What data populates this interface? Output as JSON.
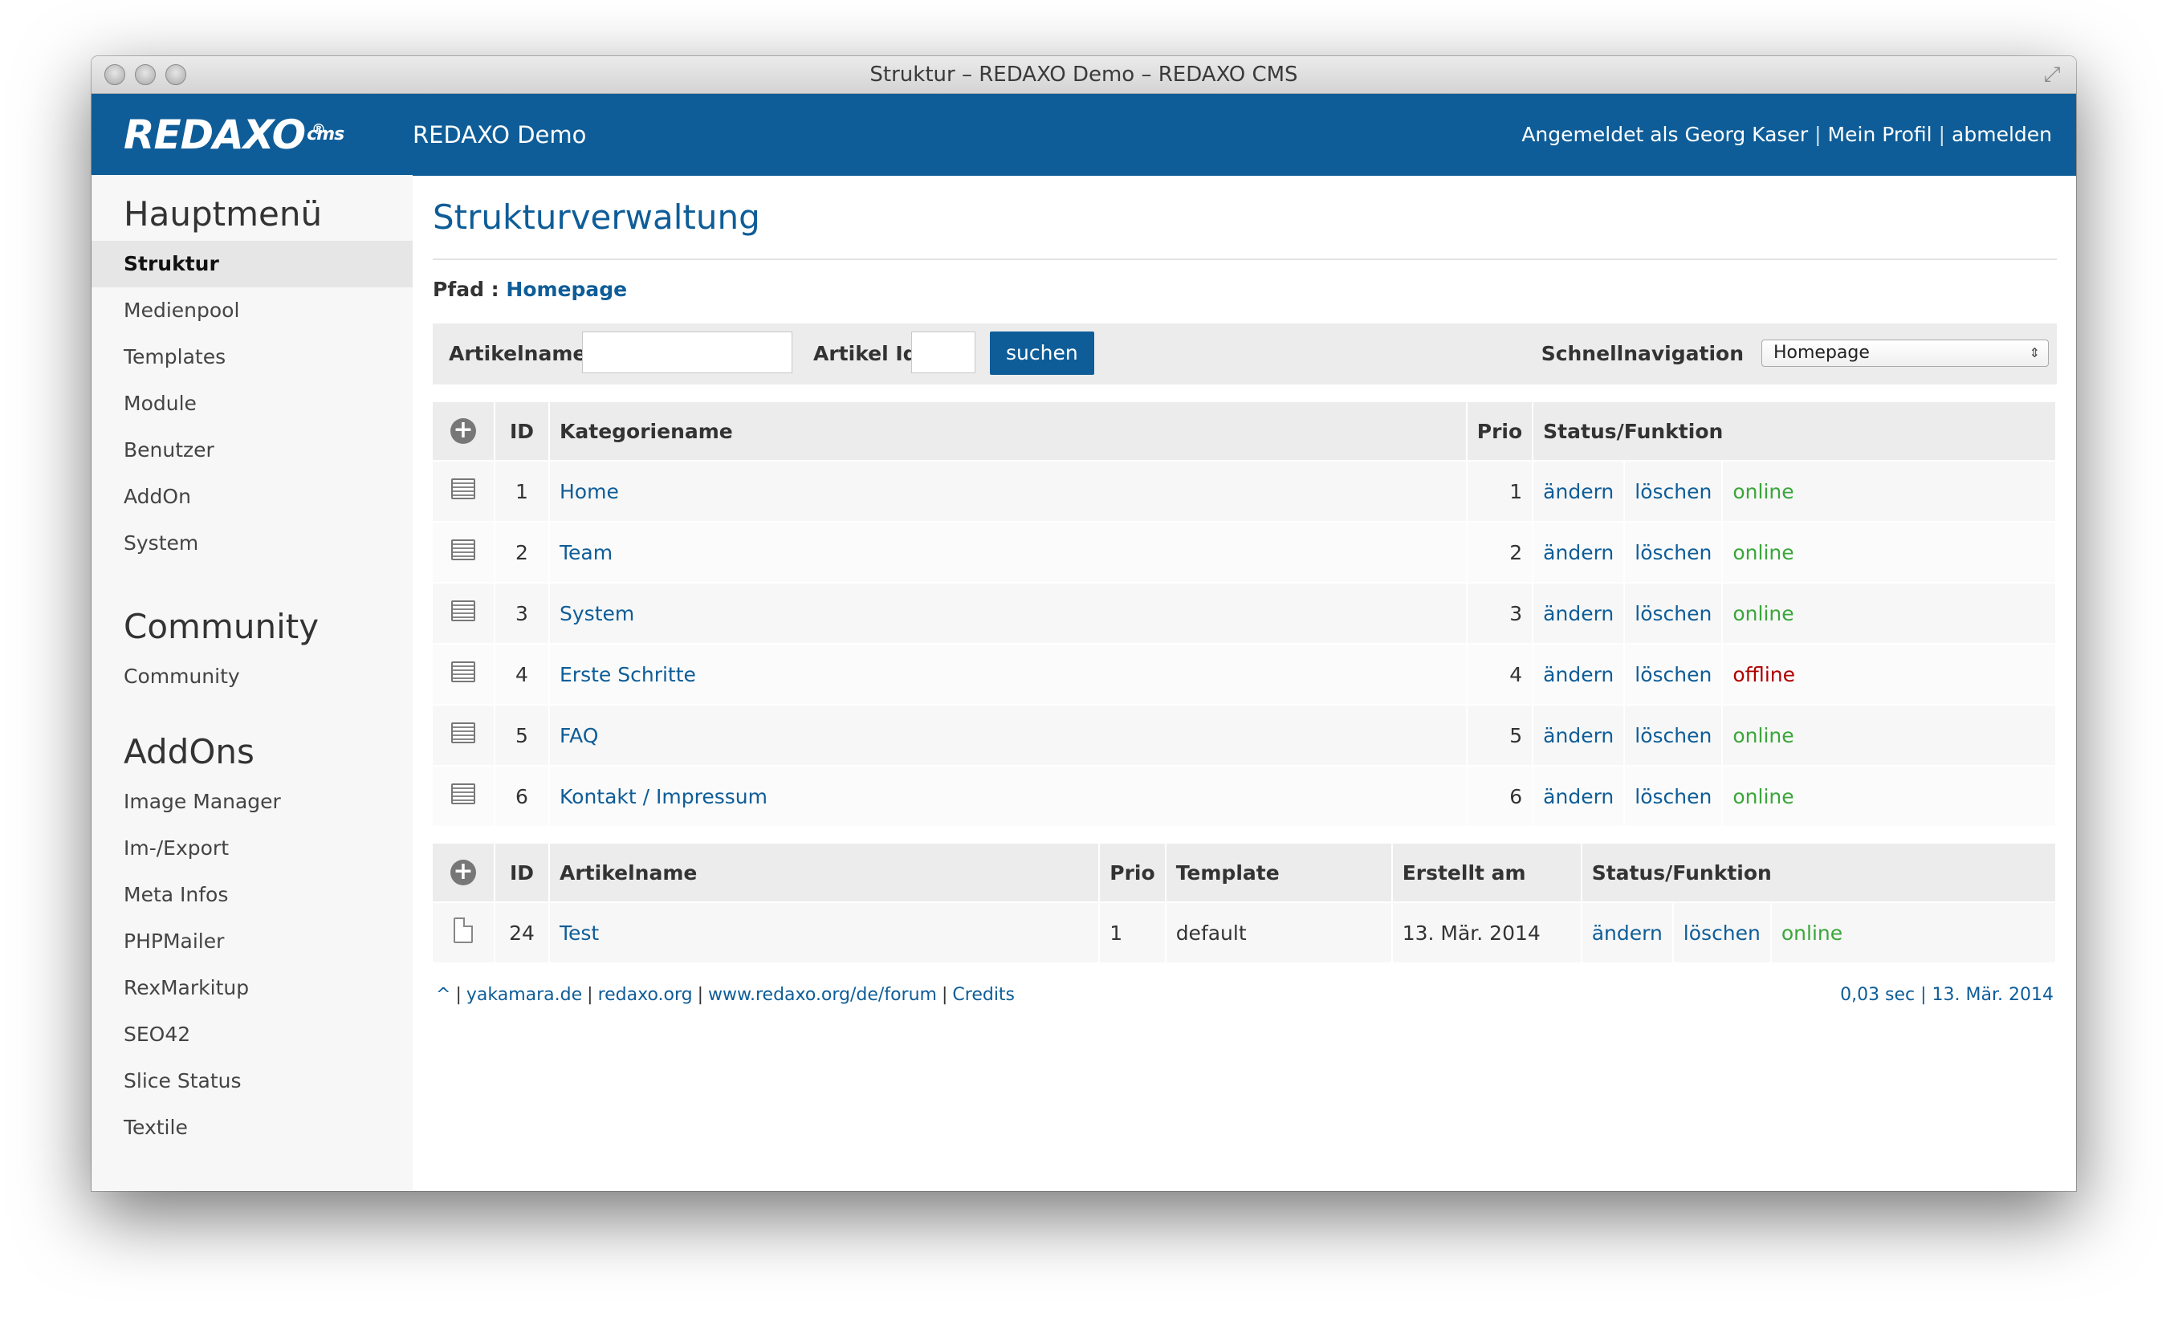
{
  "window": {
    "title": "Struktur – REDAXO Demo – REDAXO CMS"
  },
  "header": {
    "logo": "REDAXO",
    "logo_suffix": "cms",
    "logo_mark": "®",
    "site_name": "REDAXO Demo",
    "logged_in_label": "Angemeldet als Georg Kaser",
    "profile_link": "Mein Profil",
    "logout_link": "abmelden",
    "accent_color": "#0e5d98"
  },
  "sidebar": {
    "main_heading": "Hauptmenü",
    "main_items": [
      {
        "label": "Struktur",
        "active": true
      },
      {
        "label": "Medienpool"
      },
      {
        "label": "Templates"
      },
      {
        "label": "Module"
      },
      {
        "label": "Benutzer"
      },
      {
        "label": "AddOn"
      },
      {
        "label": "System"
      }
    ],
    "community_heading": "Community",
    "community_items": [
      {
        "label": "Community"
      }
    ],
    "addons_heading": "AddOns",
    "addon_items": [
      {
        "label": "Image Manager"
      },
      {
        "label": "Im-/Export"
      },
      {
        "label": "Meta Infos"
      },
      {
        "label": "PHPMailer"
      },
      {
        "label": "RexMarkitup"
      },
      {
        "label": "SEO42"
      },
      {
        "label": "Slice Status"
      },
      {
        "label": "Textile"
      }
    ]
  },
  "main": {
    "title": "Strukturverwaltung",
    "path_label": "Pfad :",
    "path_link": "Homepage",
    "search": {
      "article_name_label": "Artikelname",
      "article_name_value": "",
      "article_id_label": "Artikel Id",
      "article_id_value": "",
      "search_button": "suchen",
      "quicknav_label": "Schnellnavigation",
      "quicknav_selected": "Homepage"
    },
    "categories": {
      "headers": {
        "id": "ID",
        "name": "Kategoriename",
        "prio": "Prio",
        "status": "Status/Funktion"
      },
      "rows": [
        {
          "id": "1",
          "name": "Home",
          "prio": "1",
          "edit": "ändern",
          "delete": "löschen",
          "status": "online"
        },
        {
          "id": "2",
          "name": "Team",
          "prio": "2",
          "edit": "ändern",
          "delete": "löschen",
          "status": "online"
        },
        {
          "id": "3",
          "name": "System",
          "prio": "3",
          "edit": "ändern",
          "delete": "löschen",
          "status": "online"
        },
        {
          "id": "4",
          "name": "Erste Schritte",
          "prio": "4",
          "edit": "ändern",
          "delete": "löschen",
          "status": "offline"
        },
        {
          "id": "5",
          "name": "FAQ",
          "prio": "5",
          "edit": "ändern",
          "delete": "löschen",
          "status": "online"
        },
        {
          "id": "6",
          "name": "Kontakt / Impressum",
          "prio": "6",
          "edit": "ändern",
          "delete": "löschen",
          "status": "online"
        }
      ]
    },
    "articles": {
      "headers": {
        "id": "ID",
        "name": "Artikelname",
        "prio": "Prio",
        "template": "Template",
        "created": "Erstellt am",
        "status": "Status/Funktion"
      },
      "rows": [
        {
          "id": "24",
          "name": "Test",
          "prio": "1",
          "template": "default",
          "created": "13. Mär. 2014",
          "edit": "ändern",
          "delete": "löschen",
          "status": "online"
        }
      ]
    },
    "footer": {
      "links": [
        "^",
        "yakamara.de",
        "redaxo.org",
        "www.redaxo.org/de/forum",
        "Credits"
      ],
      "stats": "0,03 sec | 13. Mär. 2014"
    }
  }
}
